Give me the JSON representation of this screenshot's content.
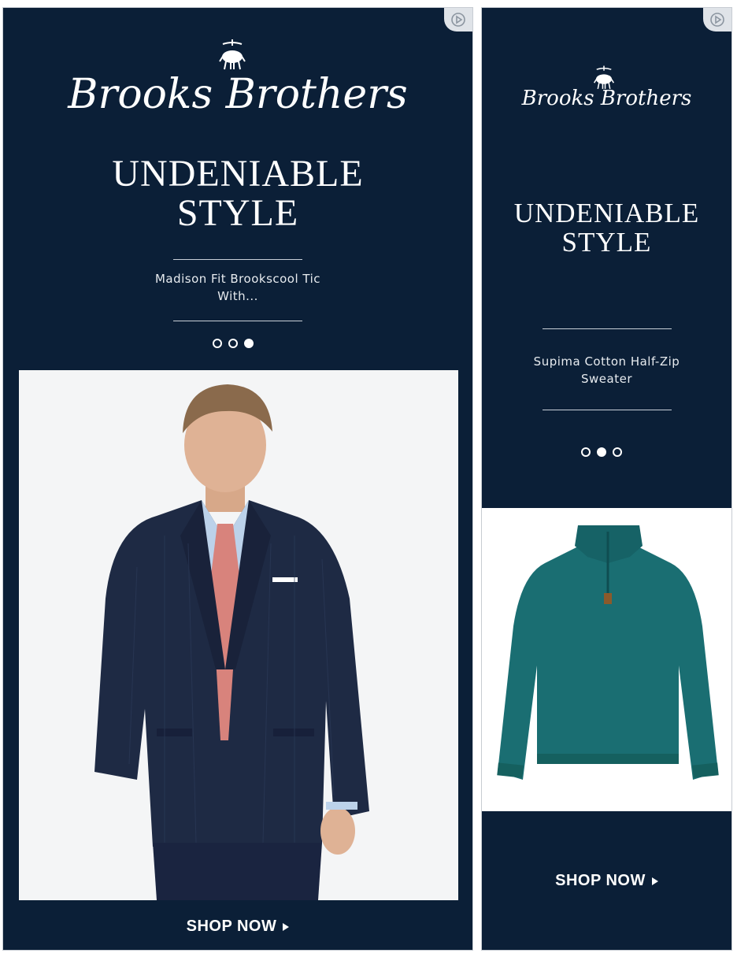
{
  "ad_large": {
    "brand": "Brooks Brothers",
    "headline_line1": "UNDENIABLE",
    "headline_line2": "STYLE",
    "product_line1": "Madison Fit Brookscool Tic",
    "product_line2": "With...",
    "carousel": {
      "count": 3,
      "active_index": 2
    },
    "cta_label": "SHOP NOW",
    "photo_icon": "man-in-suit-photo"
  },
  "ad_small": {
    "brand": "Brooks Brothers",
    "headline_line1": "UNDENIABLE",
    "headline_line2": "STYLE",
    "product_line1": "Supima Cotton Half-Zip",
    "product_line2": "Sweater",
    "carousel": {
      "count": 3,
      "active_index": 1
    },
    "cta_label": "SHOP NOW",
    "photo_icon": "teal-sweater-photo"
  },
  "colors": {
    "background": "#0b1f37",
    "text": "#ffffff",
    "sweater": "#1a6e72",
    "suit": "#1e2a44",
    "tie": "#d8837c"
  },
  "icons": [
    "adchoices-icon",
    "golden-fleece-logo-icon",
    "play-arrow-icon"
  ]
}
